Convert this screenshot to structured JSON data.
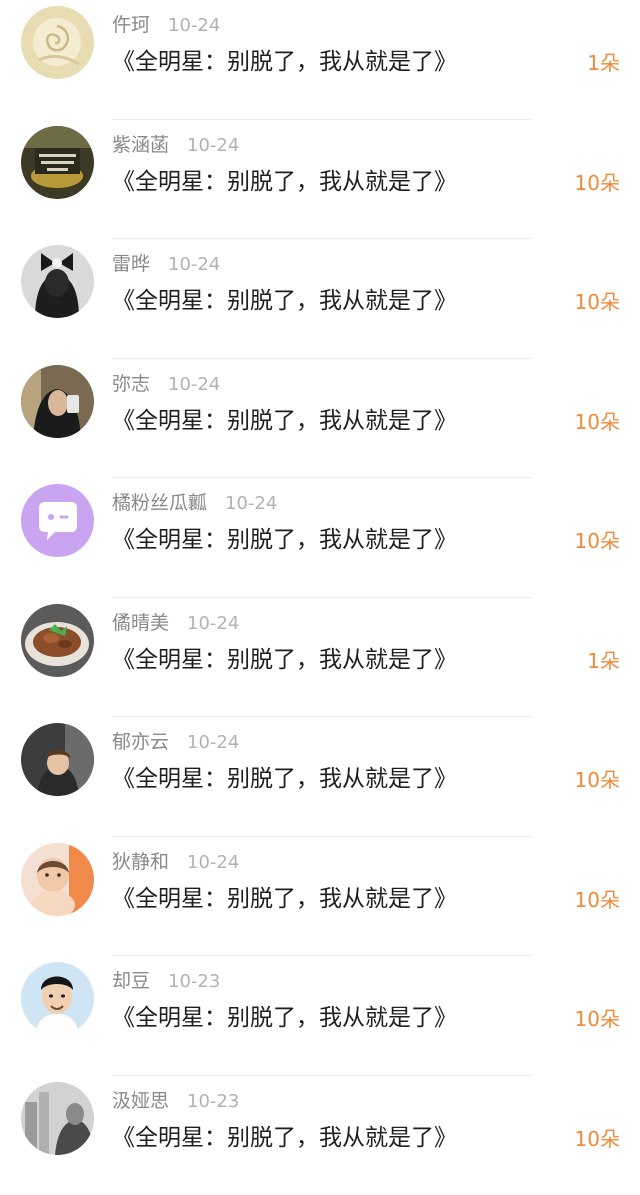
{
  "list": {
    "items": [
      {
        "name": "仵珂",
        "date": "10-24",
        "title": "《全明星：别脱了，我从就是了》",
        "count": "1朵",
        "avatar": "rose-avatar"
      },
      {
        "name": "紫涵菡",
        "date": "10-24",
        "title": "《全明星：别脱了，我从就是了》",
        "count": "10朵",
        "avatar": "september-avatar"
      },
      {
        "name": "雷晔",
        "date": "10-24",
        "title": "《全明星：别脱了，我从就是了》",
        "count": "10朵",
        "avatar": "bow-girl-avatar"
      },
      {
        "name": "弥志",
        "date": "10-24",
        "title": "《全明星：别脱了，我从就是了》",
        "count": "10朵",
        "avatar": "selfie-girl-avatar"
      },
      {
        "name": "橘粉丝瓜瓤",
        "date": "10-24",
        "title": "《全明星：别脱了，我从就是了》",
        "count": "10朵",
        "avatar": "chat-bubble-avatar"
      },
      {
        "name": "僪晴美",
        "date": "10-24",
        "title": "《全明星：别脱了，我从就是了》",
        "count": "1朵",
        "avatar": "food-avatar"
      },
      {
        "name": "郁亦云",
        "date": "10-24",
        "title": "《全明星：别脱了，我从就是了》",
        "count": "10朵",
        "avatar": "child-avatar"
      },
      {
        "name": "狄静和",
        "date": "10-24",
        "title": "《全明星：别脱了，我从就是了》",
        "count": "10朵",
        "avatar": "baby-avatar"
      },
      {
        "name": "却豆",
        "date": "10-23",
        "title": "《全明星：别脱了，我从就是了》",
        "count": "10朵",
        "avatar": "cartoon-man-avatar"
      },
      {
        "name": "汲娅思",
        "date": "10-23",
        "title": "《全明星：别脱了，我从就是了》",
        "count": "10朵",
        "avatar": "grey-photo-avatar"
      }
    ]
  },
  "colors": {
    "name": "#8a8a8a",
    "date": "#b2b2b2",
    "title": "#1f1f1f",
    "count": "#f08a3a",
    "divider": "#eeeeee",
    "chat_avatar": "#c9a4f0"
  }
}
